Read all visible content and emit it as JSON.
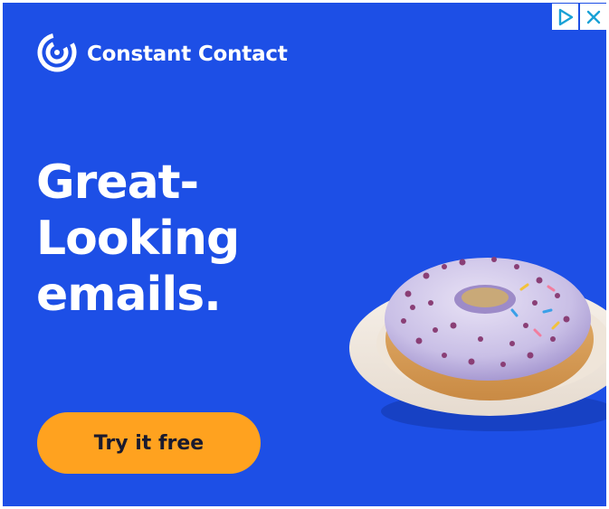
{
  "brand": {
    "name": "Constant Contact"
  },
  "headline": {
    "line1": "Great-",
    "line2": "Looking",
    "line3": "emails."
  },
  "cta": {
    "label": "Try it free"
  },
  "colors": {
    "background": "#1d4fe6",
    "cta": "#ffa21f",
    "text": "#ffffff"
  },
  "icons": {
    "logo": "constant-contact-logo-icon",
    "adchoices": "adchoices-icon",
    "close": "close-icon"
  }
}
